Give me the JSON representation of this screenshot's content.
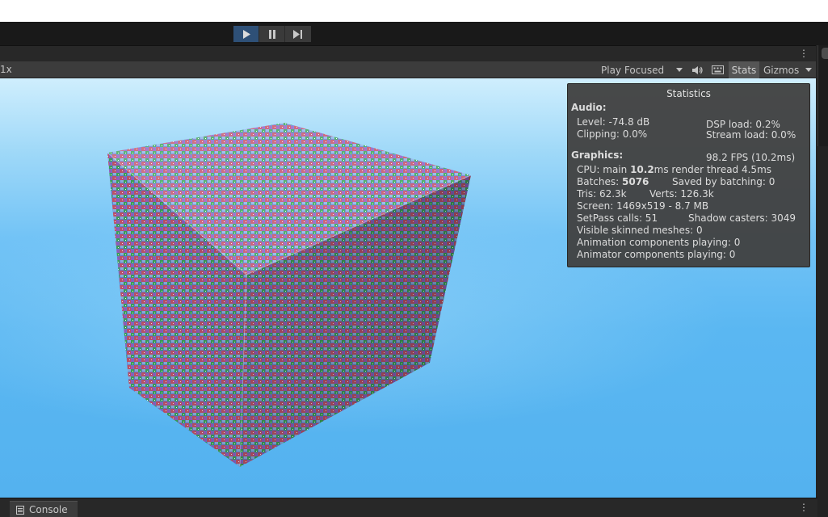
{
  "play_controls": {
    "play": "play-icon",
    "pause": "pause-icon",
    "step": "step-icon"
  },
  "game_bar": {
    "scale": "1x",
    "focus_mode": "Play Focused",
    "stats_label": "Stats",
    "gizmos_label": "Gizmos"
  },
  "stats": {
    "title": "Statistics",
    "audio_header": "Audio:",
    "level": "Level: -74.8 dB",
    "clipping": "Clipping: 0.0%",
    "dsp_load": "DSP load: 0.2%",
    "stream_load": "Stream load: 0.0%",
    "graphics_header": "Graphics:",
    "fps": "98.2 FPS (10.2ms)",
    "cpu_prefix": "CPU: main ",
    "cpu_main_value": "10.2",
    "cpu_suffix": "ms  render thread 4.5ms",
    "batches_prefix": "Batches: ",
    "batches_value": "5076",
    "saved_by_batching": "Saved by batching: 0",
    "tris": "Tris: 62.3k",
    "verts": "Verts: 126.3k",
    "screen": "Screen: 1469x519 - 8.7 MB",
    "setpass": "SetPass calls: 51",
    "shadow_casters": "Shadow casters: 3049",
    "skinned": "Visible skinned meshes: 0",
    "anim_components": "Animation components playing: 0",
    "animator_components": "Animator components playing: 0"
  },
  "bottom": {
    "console_tab": "Console"
  },
  "colors": {
    "editor_bg": "#191919",
    "panel_bg": "#282828",
    "active_play": "#2e5077",
    "sky_top": "#cfeefd",
    "sky_bottom": "#54b2ef"
  }
}
